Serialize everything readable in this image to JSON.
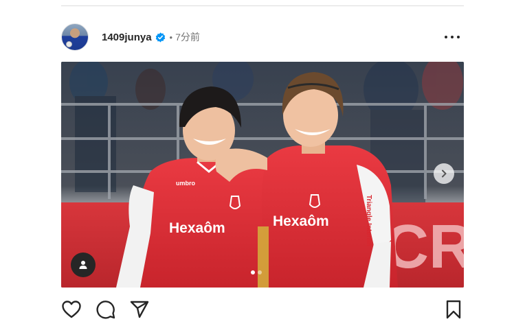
{
  "post": {
    "username": "1409junya",
    "separator": "•",
    "time": "7分前",
    "verified": true,
    "verified_color": "#0095f6"
  },
  "media": {
    "jersey_sponsor": "Hexaôm",
    "sleeve_sponsor": "Triangle Interim",
    "kit_brand": "umbro",
    "carousel_slide": 1,
    "carousel_total": 2,
    "kit_color": "#e3323b"
  },
  "icons": {
    "more": "more-options-icon",
    "next": "chevron-right-icon",
    "tag": "user-tag-icon",
    "like": "heart-icon",
    "comment": "comment-icon",
    "share": "share-icon",
    "save": "bookmark-icon"
  }
}
